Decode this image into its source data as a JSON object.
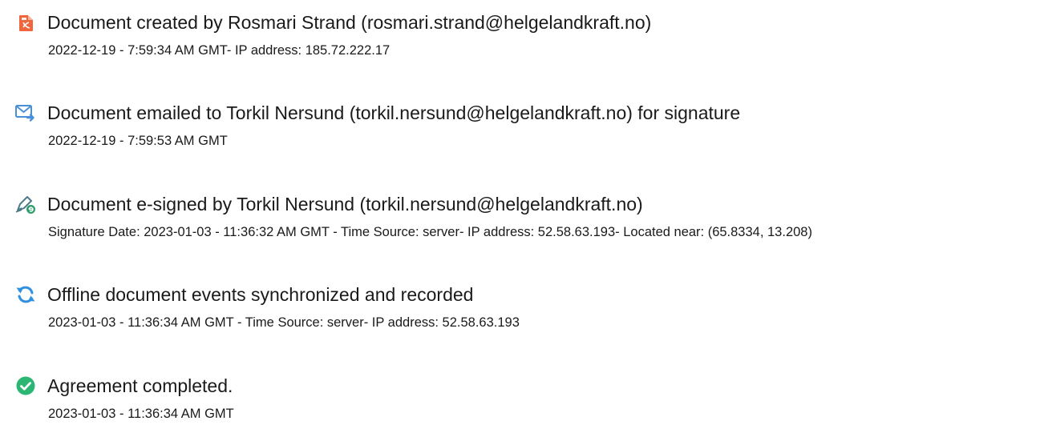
{
  "colors": {
    "created_icon": "#f0663c",
    "emailed_icon": "#4a90d9",
    "signed_icon": "#4d7a8a",
    "signed_badge": "#2e9e6b",
    "sync_icon": "#2f8fe0",
    "completed_icon": "#2bb673"
  },
  "events": [
    {
      "icon": "document-created-icon",
      "title": "Document created by Rosmari Strand (rosmari.strand@helgelandkraft.no)",
      "detail": "2022-12-19 - 7:59:34 AM GMT- IP address: 185.72.222.17"
    },
    {
      "icon": "email-sent-icon",
      "title": "Document emailed to Torkil Nersund (torkil.nersund@helgelandkraft.no) for signature",
      "detail": "2022-12-19 - 7:59:53 AM GMT"
    },
    {
      "icon": "e-signed-icon",
      "title": "Document e-signed by Torkil Nersund (torkil.nersund@helgelandkraft.no)",
      "detail": "Signature Date: 2023-01-03 - 11:36:32 AM GMT - Time Source: server- IP address: 52.58.63.193- Located near: (65.8334, 13.208)"
    },
    {
      "icon": "sync-icon",
      "title": "Offline document events synchronized and recorded",
      "detail": "2023-01-03 - 11:36:34 AM GMT - Time Source: server- IP address: 52.58.63.193"
    },
    {
      "icon": "checkmark-icon",
      "title": "Agreement completed.",
      "detail": "2023-01-03 - 11:36:34 AM GMT"
    }
  ]
}
